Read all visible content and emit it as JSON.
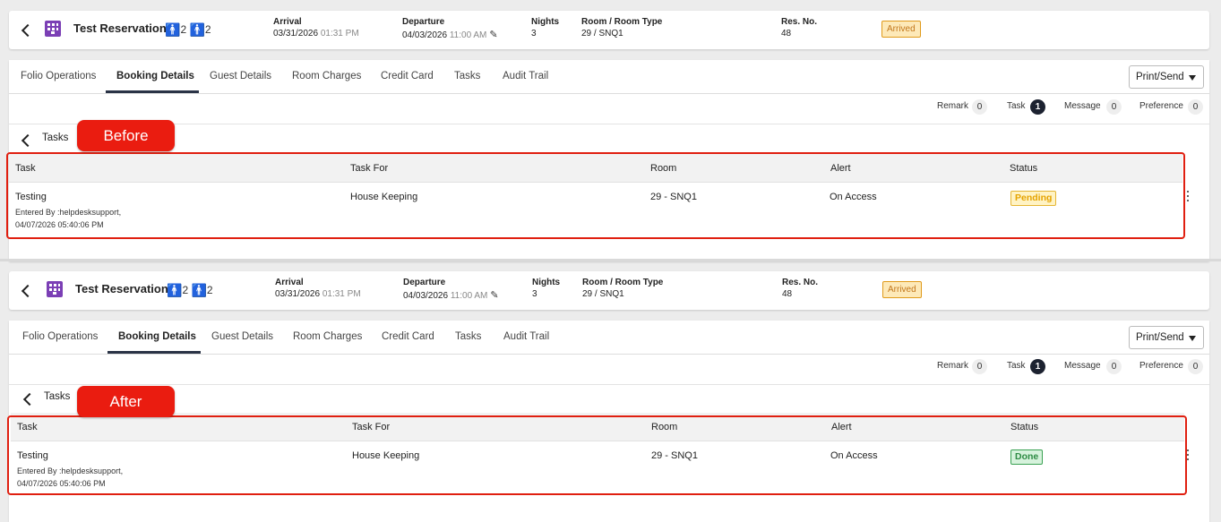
{
  "reservation": {
    "name": "Test Reservation",
    "adults": "2",
    "children": "2",
    "arrival_label": "Arrival",
    "arrival_date": "03/31/2026",
    "arrival_time": "01:31 PM",
    "departure_label": "Departure",
    "departure_date": "04/03/2026",
    "departure_time": "11:00 AM",
    "nights_label": "Nights",
    "nights": "3",
    "room_label": "Room / Room Type",
    "room": "29 / SNQ1",
    "resno_label": "Res. No.",
    "resno": "48",
    "status": "Arrived"
  },
  "tabs": [
    "Folio Operations",
    "Booking Details",
    "Guest Details",
    "Room Charges",
    "Credit Card",
    "Tasks",
    "Audit Trail"
  ],
  "active_tab": "Booking Details",
  "print_send": "Print/Send",
  "counters": {
    "remark_label": "Remark",
    "remark": "0",
    "task_label": "Task",
    "task": "1",
    "message_label": "Message",
    "message": "0",
    "preference_label": "Preference",
    "preference": "0"
  },
  "tasks_title": "Tasks",
  "columns": [
    "Task",
    "Task For",
    "Room",
    "Alert",
    "Status"
  ],
  "task_row": {
    "name": "Testing",
    "entered_by": "Entered By :helpdesksupport,",
    "entered_at": "04/07/2026 05:40:06 PM",
    "task_for": "House Keeping",
    "room": "29 - SNQ1",
    "alert": "On Access"
  },
  "before": {
    "label": "Before",
    "status": "Pending"
  },
  "after": {
    "label": "After",
    "status": "Done"
  },
  "colors": {
    "accent_red": "#ea1c10",
    "pending": "#e5a300",
    "done": "#2d8b43",
    "arrived": "#c2761a"
  }
}
